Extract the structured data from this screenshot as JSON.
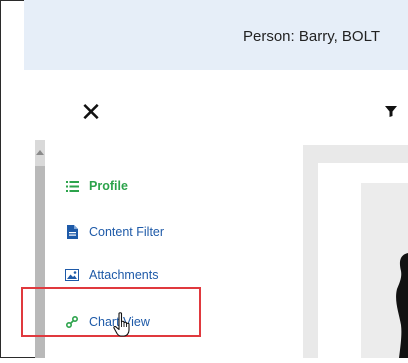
{
  "dialog": {
    "title": "Person: Barry, BOLT"
  },
  "nav": {
    "items": [
      {
        "label": "Profile",
        "icon": "list-icon",
        "active": true
      },
      {
        "label": "Content Filter",
        "icon": "document-icon"
      },
      {
        "label": "Attachments",
        "icon": "image-icon"
      },
      {
        "label": "Chart View",
        "icon": "link-icon"
      }
    ]
  },
  "colors": {
    "active": "#2ca34b",
    "link": "#1e5aa8",
    "highlight": "#e0393e",
    "title_bar": "#e6eef8"
  }
}
